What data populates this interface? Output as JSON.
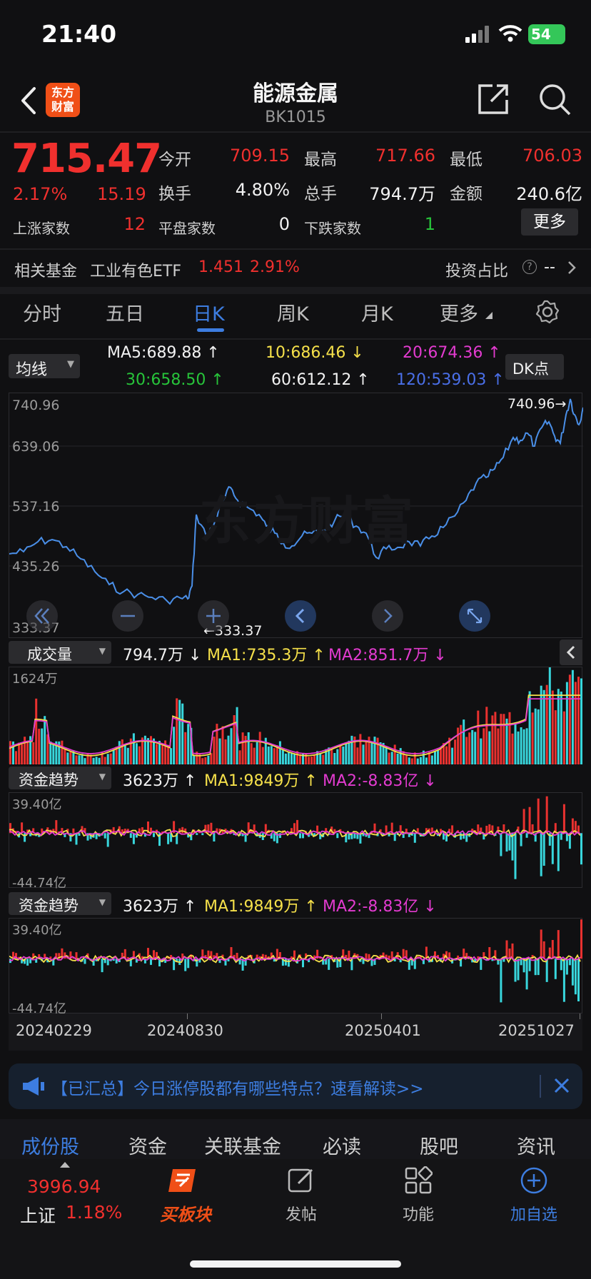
{
  "status_bar": {
    "time": "21:40",
    "battery": "54"
  },
  "header": {
    "title": "能源金属",
    "code": "BK1015",
    "logo_text": "东方财富"
  },
  "quote": {
    "price": "715.47",
    "change_pct": "2.17%",
    "change": "15.19",
    "open_label": "今开",
    "open": "709.15",
    "high_label": "最高",
    "high": "717.66",
    "low_label": "最低",
    "low": "706.03",
    "turnover_label": "换手",
    "turnover": "4.80%",
    "volume_label": "总手",
    "volume": "794.7万",
    "amount_label": "金额",
    "amount": "240.6亿",
    "up_label": "上涨家数",
    "up": "12",
    "flat_label": "平盘家数",
    "flat": "0",
    "down_label": "下跌家数",
    "down": "1",
    "more_label": "更多"
  },
  "fund": {
    "label": "相关基金",
    "name": "工业有色ETF",
    "price": "1.451",
    "pct": "2.91%",
    "ratio_label": "投资占比",
    "ratio_value": "--"
  },
  "tabs": [
    "分时",
    "五日",
    "日K",
    "周K",
    "月K",
    "更多"
  ],
  "active_tab": "日K",
  "ma_panel": {
    "selector": "均线",
    "ma5": "MA5:689.88",
    "ma10": "10:686.46",
    "ma20": "20:674.36",
    "ma30": "30:658.50",
    "ma60": "60:612.12",
    "ma120": "120:539.03",
    "dk_label": "DK点"
  },
  "price_axis": {
    "t1": "740.96",
    "t2": "639.06",
    "t3": "537.16",
    "t4": "435.26",
    "t5": "333.37",
    "max_marker": "740.96",
    "min_marker": "333.37"
  },
  "watermark": "东方财富",
  "volume_panel": {
    "selector": "成交量",
    "value": "794.7万",
    "ma1": "MA1:735.3万",
    "ma2": "MA2:851.7万",
    "axis_top": "1624万"
  },
  "fund_panel_1": {
    "selector": "资金趋势",
    "value": "3623万",
    "ma1": "MA1:9849万",
    "ma2": "MA2:-8.83亿",
    "axis_top": "39.40亿",
    "axis_bottom": "-44.74亿"
  },
  "fund_panel_2": {
    "selector": "资金趋势",
    "value": "3623万",
    "ma1": "MA1:9849万",
    "ma2": "MA2:-8.83亿",
    "axis_top": "39.40亿",
    "axis_bottom": "-44.74亿"
  },
  "dates": [
    "20240229",
    "20240830",
    "20250401",
    "20251027"
  ],
  "notice": {
    "text": "【已汇总】今日涨停股都有哪些特点？速看解读>>"
  },
  "bottom_tabs": [
    "成份股",
    "资金",
    "关联基金",
    "必读",
    "股吧",
    "资讯"
  ],
  "nav": {
    "index_value": "3996.94",
    "index_name": "上证",
    "index_pct": "1.18%",
    "buy_label": "买板块",
    "post_label": "发帖",
    "func_label": "功能",
    "add_label": "加自选"
  },
  "colors": {
    "up": "#f0302e",
    "down": "#27c43a",
    "accent": "#3d7de0",
    "price_line": "#4a8fe8",
    "ma1": "#f5e04a",
    "ma2": "#e33bd0",
    "bar_up": "#e8312f",
    "bar_down": "#38d6dc"
  }
}
